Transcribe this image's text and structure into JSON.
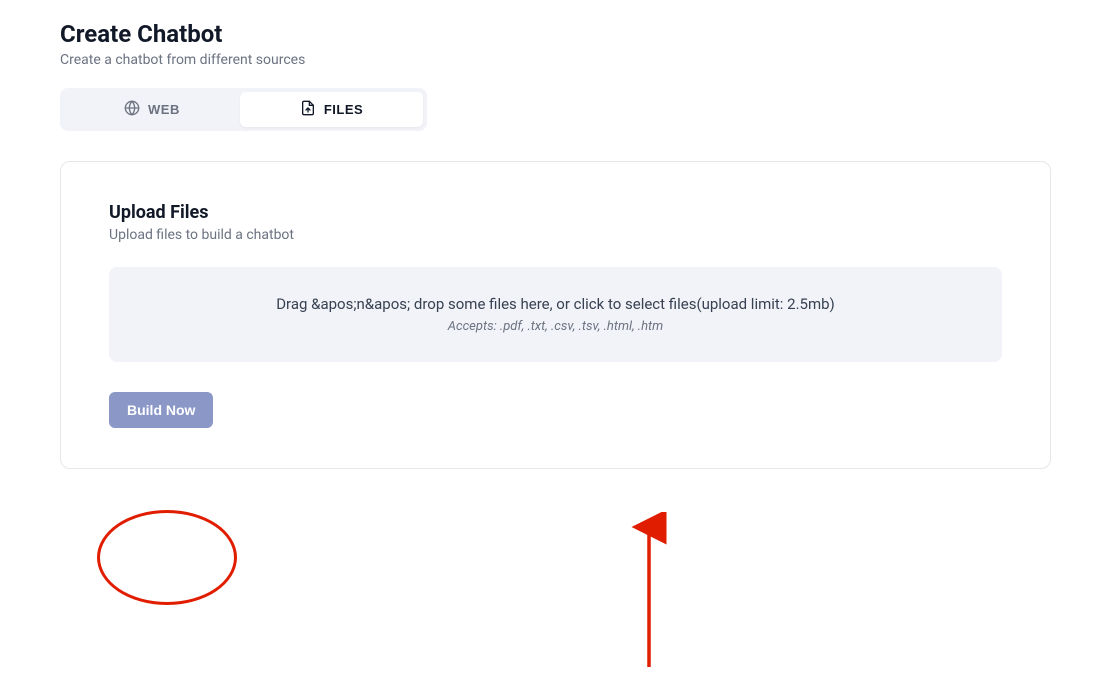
{
  "header": {
    "title": "Create Chatbot",
    "subtitle": "Create a chatbot from different sources"
  },
  "tabs": {
    "web": {
      "label": "WEB",
      "icon": "globe-icon"
    },
    "files": {
      "label": "FILES",
      "icon": "file-up-icon",
      "active": true
    }
  },
  "upload": {
    "title": "Upload Files",
    "subtitle": "Upload files to build a chatbot",
    "dropzone_text": "Drag &apos;n&apos; drop some files here, or click to select files(upload limit: 2.5mb)",
    "accepts": "Accepts: .pdf, .txt, .csv, .tsv, .html, .htm"
  },
  "actions": {
    "build": "Build Now"
  },
  "annotations": {
    "circle_color": "#e11d00",
    "arrow_color": "#e11d00"
  }
}
